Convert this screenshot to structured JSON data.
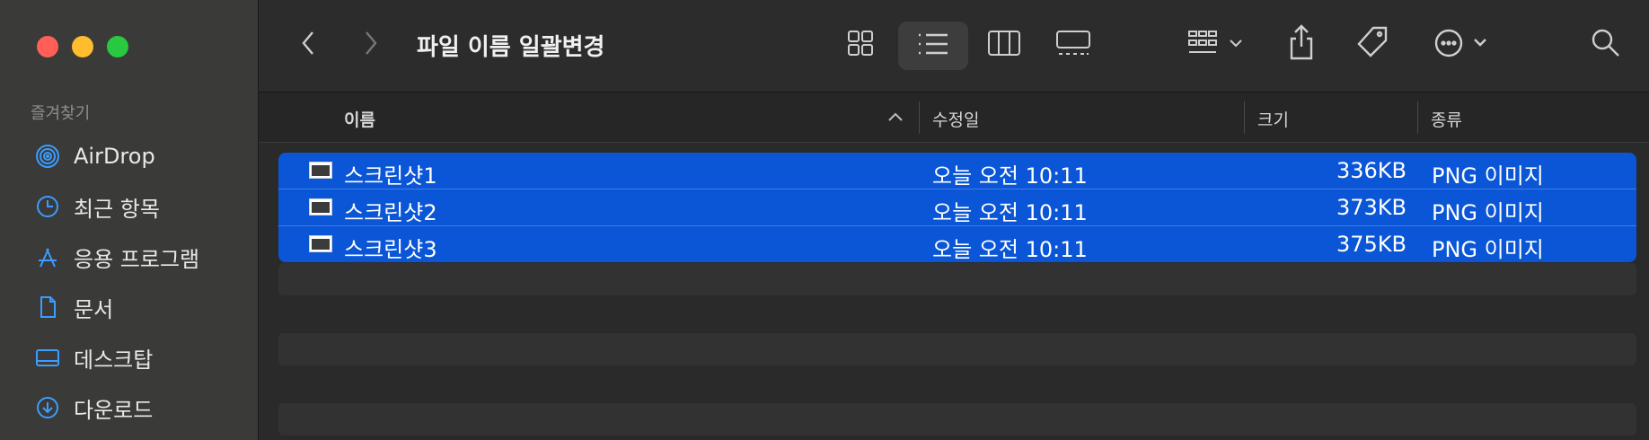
{
  "window": {
    "title": "파일 이름 일괄변경"
  },
  "colors": {
    "selection": "#0a56d6",
    "accent": "#3c9cff",
    "close": "#ff5f57",
    "minimize": "#febc2e",
    "zoom": "#28c840"
  },
  "sidebar": {
    "section_title": "즐겨찾기",
    "items": [
      {
        "label": "AirDrop",
        "icon": "airdrop-icon"
      },
      {
        "label": "최근 항목",
        "icon": "clock-icon"
      },
      {
        "label": "응용 프로그램",
        "icon": "applications-icon"
      },
      {
        "label": "문서",
        "icon": "document-icon"
      },
      {
        "label": "데스크탑",
        "icon": "desktop-icon"
      },
      {
        "label": "다운로드",
        "icon": "download-icon"
      }
    ]
  },
  "columns": {
    "name": "이름",
    "modified": "수정일",
    "size": "크기",
    "kind": "종류",
    "sort": "ascending-by-name"
  },
  "files": [
    {
      "name": "스크린샷1",
      "modified": "오늘 오전 10:11",
      "size": "336KB",
      "kind": "PNG 이미지"
    },
    {
      "name": "스크린샷2",
      "modified": "오늘 오전 10:11",
      "size": "373KB",
      "kind": "PNG 이미지"
    },
    {
      "name": "스크린샷3",
      "modified": "오늘 오전 10:11",
      "size": "375KB",
      "kind": "PNG 이미지"
    }
  ]
}
